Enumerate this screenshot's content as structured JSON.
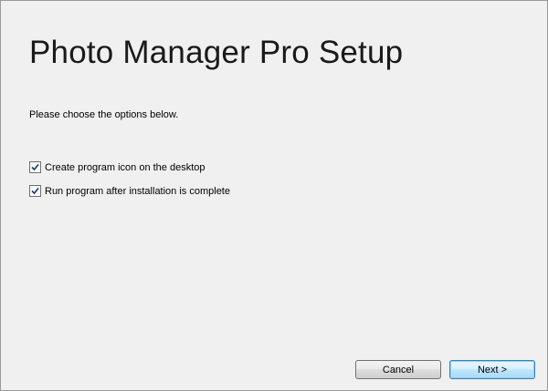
{
  "setup": {
    "title": "Photo Manager Pro Setup",
    "instruction": "Please choose the options below."
  },
  "options": [
    {
      "label": "Create program icon on the desktop",
      "checked": true
    },
    {
      "label": "Run program after installation is complete",
      "checked": true
    }
  ],
  "buttons": {
    "cancel_label": "Cancel",
    "next_label": "Next >"
  },
  "colors": {
    "background": "#f0f0f0",
    "next_button_accent": "#3c7fb1",
    "checkmark": "#1e3a6e"
  },
  "icons": {
    "checkbox_check": "checkmark-icon"
  }
}
